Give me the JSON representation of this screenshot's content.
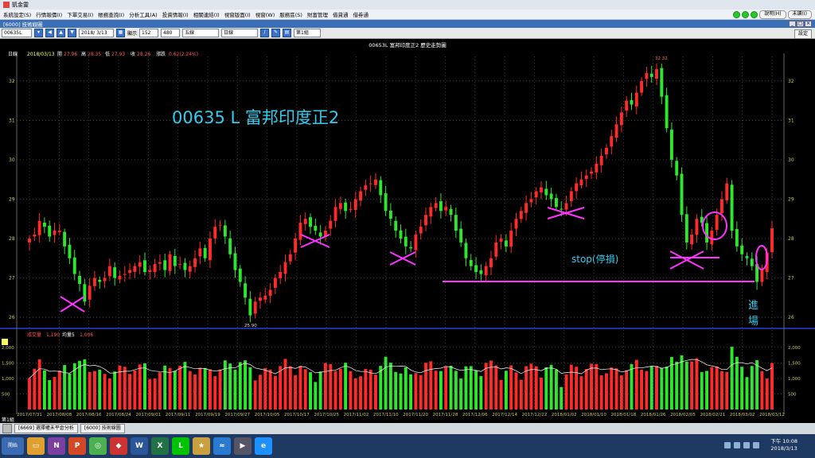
{
  "app": {
    "title": "凱金靈"
  },
  "menu": {
    "items": [
      "系統設定(S)",
      "行情報價(I)",
      "下單交易(I)",
      "帳務查詢(I)",
      "分析工具(A)",
      "投資情報(I)",
      "相關連結(I)",
      "視窗版面(I)",
      "視窗(W)",
      "服務區(S)",
      "財富管理",
      "借貸通",
      "借券通"
    ],
    "help_label": "說明(H)",
    "user_label": "未讀(I)"
  },
  "subwindow": {
    "title": "[6000] 技術線圖",
    "settings_label": "設定"
  },
  "toolbar": {
    "symbol": "00635L",
    "date": "2018/ 3/13",
    "bars_label": "顯示",
    "bars_value": "152",
    "total_value": "480",
    "period": "五線",
    "interval": "日線",
    "group": "第1組"
  },
  "chart_header": {
    "title": "00653L 富邦印度正2 歷史走勢圖",
    "period_tag": "日線",
    "date": "2018/03/13",
    "open_label": "開",
    "open_value": "27.96",
    "high_label": "高",
    "high_value": "28.35",
    "low_label": "低",
    "low_value": "27.93",
    "close_label": "收",
    "close_value": "28.26",
    "change_label": "漲跌",
    "change_value": "0.62(2.24%)"
  },
  "annotations": {
    "big_title": "00635 L 富邦印度正2",
    "stop_label": "stop(停損)",
    "entry_label": "進\n場",
    "max_label": "32.32",
    "min_label": "25.90"
  },
  "volume_header": {
    "corner": "▼",
    "label": "成交量",
    "value": "1,190",
    "ma_label": "均量5",
    "ma_value": "1,006"
  },
  "bottom_left_label": "第1組",
  "tabs": [
    "[6669] 選擇權未平倉分析",
    "[6000] 技術線圖"
  ],
  "clock": {
    "time": "下午 10:08",
    "date": "2018/3/13"
  },
  "taskbar": {
    "start_label": "開始",
    "icons": [
      "folder-icon",
      "onenote-icon",
      "powerpoint-icon",
      "chrome-icon",
      "app-icon",
      "word-icon",
      "excel-icon",
      "line-icon",
      "trading-icon",
      "wave-icon",
      "media-icon",
      "ie-icon"
    ]
  },
  "colors": {
    "up": "#ff2a2a",
    "down": "#2fe62f",
    "annotation": "#ff33ff",
    "grid": "#5a5a5a",
    "axis_text": "#cccc66"
  },
  "chart_data": {
    "type": "candlestick",
    "title": "00653L 富邦印度正2 歷史走勢圖",
    "ylim": [
      25.8,
      32.5
    ],
    "yticks": [
      26,
      27,
      28,
      29,
      30,
      31,
      32
    ],
    "volume_ylim": [
      0,
      2250
    ],
    "volume_yticks": [
      500,
      1000,
      1500,
      2000
    ],
    "volume_tick_labels": [
      "500",
      "1,000",
      "1,500",
      "2,000"
    ],
    "xtick_labels": [
      "2017/07/31",
      "2017/08/08",
      "2017/08/16",
      "2017/08/24",
      "2017/09/01",
      "2017/09/11",
      "2017/09/19",
      "2017/09/27",
      "2017/10/05",
      "2017/10/17",
      "2017/10/25",
      "2017/11/02",
      "2017/11/10",
      "2017/11/20",
      "2017/11/28",
      "2017/12/06",
      "2017/12/14",
      "2017/12/22",
      "2018/01/02",
      "2018/01/10",
      "2018/01/18",
      "2018/01/26",
      "2018/02/05",
      "2018/02/21",
      "2018/03/02",
      "2018/03/12"
    ],
    "close": [
      28.0,
      28.1,
      28.45,
      28.3,
      28.05,
      28.2,
      28.2,
      27.8,
      27.5,
      27.1,
      26.85,
      26.4,
      26.8,
      27.0,
      26.9,
      27.0,
      27.3,
      27.0,
      27.05,
      27.1,
      27.2,
      27.3,
      27.4,
      27.15,
      27.2,
      27.35,
      27.4,
      27.2,
      27.6,
      27.3,
      27.35,
      27.2,
      27.3,
      27.5,
      27.75,
      27.5,
      28.0,
      28.3,
      28.35,
      28.05,
      27.6,
      27.2,
      26.9,
      26.5,
      26.05,
      26.4,
      26.5,
      26.55,
      26.7,
      27.0,
      27.15,
      27.4,
      27.6,
      28.0,
      28.4,
      28.5,
      28.3,
      28.2,
      28.05,
      28.2,
      28.45,
      28.8,
      28.9,
      28.7,
      28.75,
      29.0,
      29.2,
      29.35,
      29.4,
      29.5,
      29.1,
      28.7,
      28.5,
      28.2,
      28.0,
      27.8,
      27.75,
      28.1,
      28.3,
      28.6,
      28.8,
      28.9,
      28.7,
      28.8,
      28.6,
      28.2,
      27.9,
      27.5,
      27.3,
      27.15,
      27.1,
      27.3,
      27.5,
      27.9,
      28.0,
      27.8,
      28.2,
      28.5,
      28.7,
      28.9,
      29.0,
      29.2,
      29.3,
      29.1,
      29.0,
      28.8,
      28.75,
      28.9,
      29.2,
      29.4,
      29.5,
      29.6,
      29.7,
      29.9,
      30.1,
      30.3,
      30.6,
      30.9,
      31.2,
      31.5,
      31.4,
      31.7,
      32.0,
      32.2,
      32.1,
      32.3,
      31.6,
      30.8,
      30.0,
      29.6,
      28.6,
      27.9,
      28.1,
      28.5,
      28.4,
      27.9,
      28.2,
      28.6,
      29.0,
      29.4,
      28.2,
      27.8,
      27.6,
      27.5,
      27.3,
      26.9,
      27.2,
      27.64,
      28.26
    ]
  }
}
